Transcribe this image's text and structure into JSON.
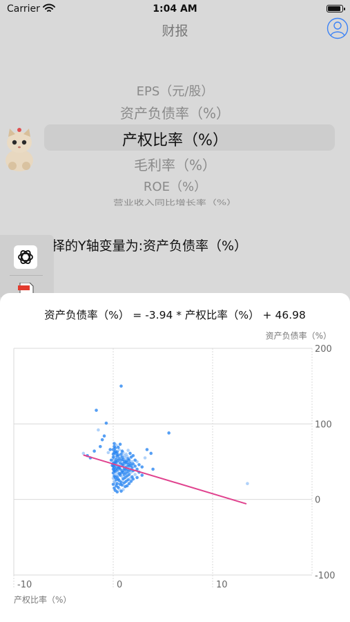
{
  "status_bar": {
    "carrier": "Carrier",
    "time": "1:04 AM"
  },
  "nav": {
    "title": "财报"
  },
  "picker": {
    "items": [
      "EPS（元/股）",
      "资产负债率（%）",
      "产权比率（%）",
      "毛利率（%）",
      "ROE（%）",
      "营业收入同比增长率（%）"
    ],
    "selected": "产权比率（%）"
  },
  "prompt": {
    "text": "择的Y轴变量为:资产负债率（%）"
  },
  "sidebar": {
    "icons": [
      "openai-icon",
      "pdf-icon"
    ]
  },
  "regression": {
    "equation": "资产负债率（%） = -3.94 * 产权比率（%） + 46.98"
  },
  "colors": {
    "point": "#1e7ff0",
    "regression_line": "#e0428e",
    "grid": "#d9d9d9",
    "picker_highlight": "#cdcdcd"
  },
  "chart_data": {
    "type": "scatter",
    "xlabel": "产权比率（%）",
    "ylabel": "资产负债率（%）",
    "xticks": [
      "-10",
      "0",
      "10"
    ],
    "yticks": [
      "200",
      "100",
      "0",
      "-100"
    ],
    "xlim": [
      -10,
      20
    ],
    "ylim": [
      -100,
      200
    ],
    "grid": true,
    "regression": {
      "slope": -3.94,
      "intercept": 46.98,
      "x_range": [
        -3,
        13.4
      ]
    },
    "points": [
      [
        -3,
        61
      ],
      [
        -2.6,
        58
      ],
      [
        -2.3,
        55
      ],
      [
        -1.9,
        64
      ],
      [
        -1.7,
        118
      ],
      [
        -1.5,
        92
      ],
      [
        -1.3,
        70
      ],
      [
        -1.1,
        79
      ],
      [
        -0.9,
        84
      ],
      [
        -0.7,
        101
      ],
      [
        -0.5,
        62
      ],
      [
        -0.3,
        66
      ],
      [
        -0.2,
        52
      ],
      [
        -0.1,
        45
      ],
      [
        0,
        20
      ],
      [
        0,
        28
      ],
      [
        0,
        35
      ],
      [
        0,
        40
      ],
      [
        0,
        44
      ],
      [
        0,
        48
      ],
      [
        0,
        52
      ],
      [
        0,
        56
      ],
      [
        0,
        60
      ],
      [
        0,
        66
      ],
      [
        0.1,
        15
      ],
      [
        0.1,
        24
      ],
      [
        0.1,
        31
      ],
      [
        0.1,
        38
      ],
      [
        0.1,
        42
      ],
      [
        0.1,
        47
      ],
      [
        0.1,
        55
      ],
      [
        0.1,
        62
      ],
      [
        0.1,
        70
      ],
      [
        0.1,
        74
      ],
      [
        0.2,
        12
      ],
      [
        0.2,
        22
      ],
      [
        0.2,
        29
      ],
      [
        0.2,
        37
      ],
      [
        0.2,
        45
      ],
      [
        0.2,
        50
      ],
      [
        0.2,
        58
      ],
      [
        0.2,
        64
      ],
      [
        0.2,
        68
      ],
      [
        0.3,
        18
      ],
      [
        0.3,
        26
      ],
      [
        0.3,
        33
      ],
      [
        0.3,
        41
      ],
      [
        0.3,
        49
      ],
      [
        0.3,
        53
      ],
      [
        0.3,
        61
      ],
      [
        0.3,
        72
      ],
      [
        0.4,
        10
      ],
      [
        0.4,
        21
      ],
      [
        0.4,
        30
      ],
      [
        0.4,
        39
      ],
      [
        0.4,
        46
      ],
      [
        0.4,
        57
      ],
      [
        0.4,
        63
      ],
      [
        0.5,
        16
      ],
      [
        0.5,
        27
      ],
      [
        0.5,
        36
      ],
      [
        0.5,
        43
      ],
      [
        0.5,
        51
      ],
      [
        0.5,
        59
      ],
      [
        0.5,
        69
      ],
      [
        0.6,
        14
      ],
      [
        0.6,
        25
      ],
      [
        0.6,
        34
      ],
      [
        0.6,
        42
      ],
      [
        0.6,
        54
      ],
      [
        0.6,
        66
      ],
      [
        0.7,
        20
      ],
      [
        0.7,
        32
      ],
      [
        0.7,
        40
      ],
      [
        0.7,
        48
      ],
      [
        0.7,
        57
      ],
      [
        0.7,
        73
      ],
      [
        0.8,
        11
      ],
      [
        0.8,
        23
      ],
      [
        0.8,
        35
      ],
      [
        0.8,
        44
      ],
      [
        0.8,
        52
      ],
      [
        0.8,
        60
      ],
      [
        0.8,
        150
      ],
      [
        0.9,
        19
      ],
      [
        0.9,
        30
      ],
      [
        0.9,
        38
      ],
      [
        0.9,
        47
      ],
      [
        0.9,
        56
      ],
      [
        0.9,
        64
      ],
      [
        1.0,
        13
      ],
      [
        1.0,
        27
      ],
      [
        1.0,
        36
      ],
      [
        1.0,
        45
      ],
      [
        1.0,
        53
      ],
      [
        1.0,
        62
      ],
      [
        1.1,
        22
      ],
      [
        1.1,
        33
      ],
      [
        1.1,
        41
      ],
      [
        1.1,
        50
      ],
      [
        1.1,
        58
      ],
      [
        1.2,
        17
      ],
      [
        1.2,
        29
      ],
      [
        1.2,
        39
      ],
      [
        1.2,
        48
      ],
      [
        1.2,
        55
      ],
      [
        1.3,
        24
      ],
      [
        1.3,
        35
      ],
      [
        1.3,
        43
      ],
      [
        1.3,
        51
      ],
      [
        1.3,
        60
      ],
      [
        1.4,
        18
      ],
      [
        1.4,
        31
      ],
      [
        1.4,
        40
      ],
      [
        1.4,
        49
      ],
      [
        1.4,
        57
      ],
      [
        1.5,
        26
      ],
      [
        1.5,
        37
      ],
      [
        1.5,
        46
      ],
      [
        1.5,
        54
      ],
      [
        1.5,
        65
      ],
      [
        1.6,
        21
      ],
      [
        1.6,
        33
      ],
      [
        1.6,
        44
      ],
      [
        1.6,
        52
      ],
      [
        1.7,
        28
      ],
      [
        1.7,
        39
      ],
      [
        1.7,
        48
      ],
      [
        1.7,
        61
      ],
      [
        1.8,
        24
      ],
      [
        1.8,
        36
      ],
      [
        1.8,
        45
      ],
      [
        1.8,
        56
      ],
      [
        1.9,
        30
      ],
      [
        1.9,
        42
      ],
      [
        1.9,
        50
      ],
      [
        2.0,
        27
      ],
      [
        2.0,
        38
      ],
      [
        2.0,
        47
      ],
      [
        2.0,
        58
      ],
      [
        2.2,
        33
      ],
      [
        2.2,
        44
      ],
      [
        2.2,
        52
      ],
      [
        2.4,
        29
      ],
      [
        2.4,
        40
      ],
      [
        2.4,
        50
      ],
      [
        2.6,
        36
      ],
      [
        2.6,
        46
      ],
      [
        2.9,
        32
      ],
      [
        2.9,
        43
      ],
      [
        3.2,
        55
      ],
      [
        3.4,
        66
      ],
      [
        3.8,
        61
      ],
      [
        4.0,
        40
      ],
      [
        5.6,
        88
      ],
      [
        13.5,
        21
      ]
    ]
  }
}
